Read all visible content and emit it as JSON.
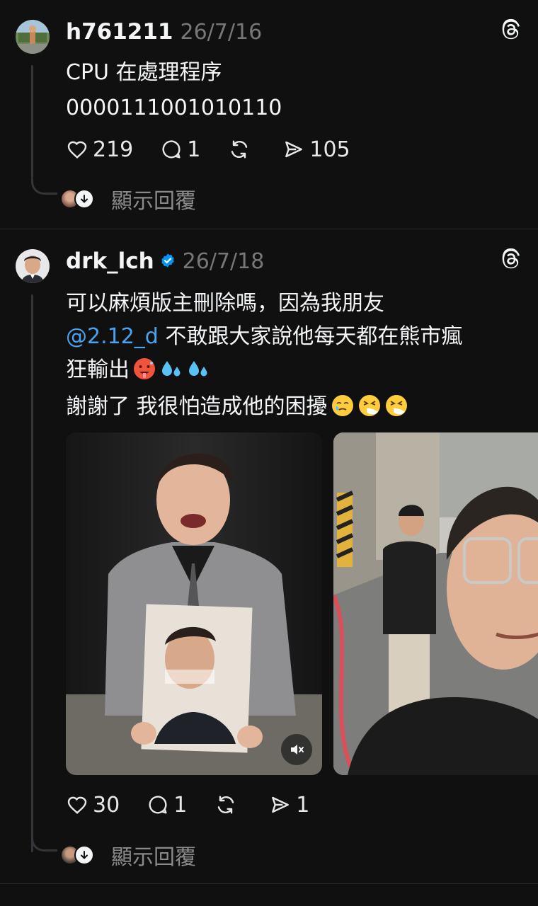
{
  "posts": [
    {
      "username": "h761211",
      "date": "26/7/16",
      "lines": [
        "CPU 在處理程序",
        "0000111001010110"
      ],
      "likes": "219",
      "replies": "1",
      "shares": "105",
      "show_replies": "顯示回覆"
    },
    {
      "username": "drk_lch",
      "date": "26/7/18",
      "line1": "可以麻煩版主刪除嗎，因為我朋友",
      "mention": "@2.12_d",
      "line2_rest": " 不敢跟大家說他每天都在熊市瘋",
      "line3": "狂輸出",
      "line4": "謝謝了 我很怕造成他的困擾",
      "likes": "30",
      "replies": "1",
      "shares": "1",
      "show_replies": "顯示回覆"
    }
  ],
  "icons": {
    "like": "heart-icon",
    "reply": "comment-icon",
    "repost": "repost-icon",
    "share": "send-icon",
    "brand": "threads-logo-icon",
    "verified": "verified-badge-icon",
    "mute": "muted-speaker-icon"
  },
  "colors": {
    "background": "#101010",
    "mention": "#4aa3f0",
    "verified": "#0095f6",
    "muted_text": "#777777"
  }
}
